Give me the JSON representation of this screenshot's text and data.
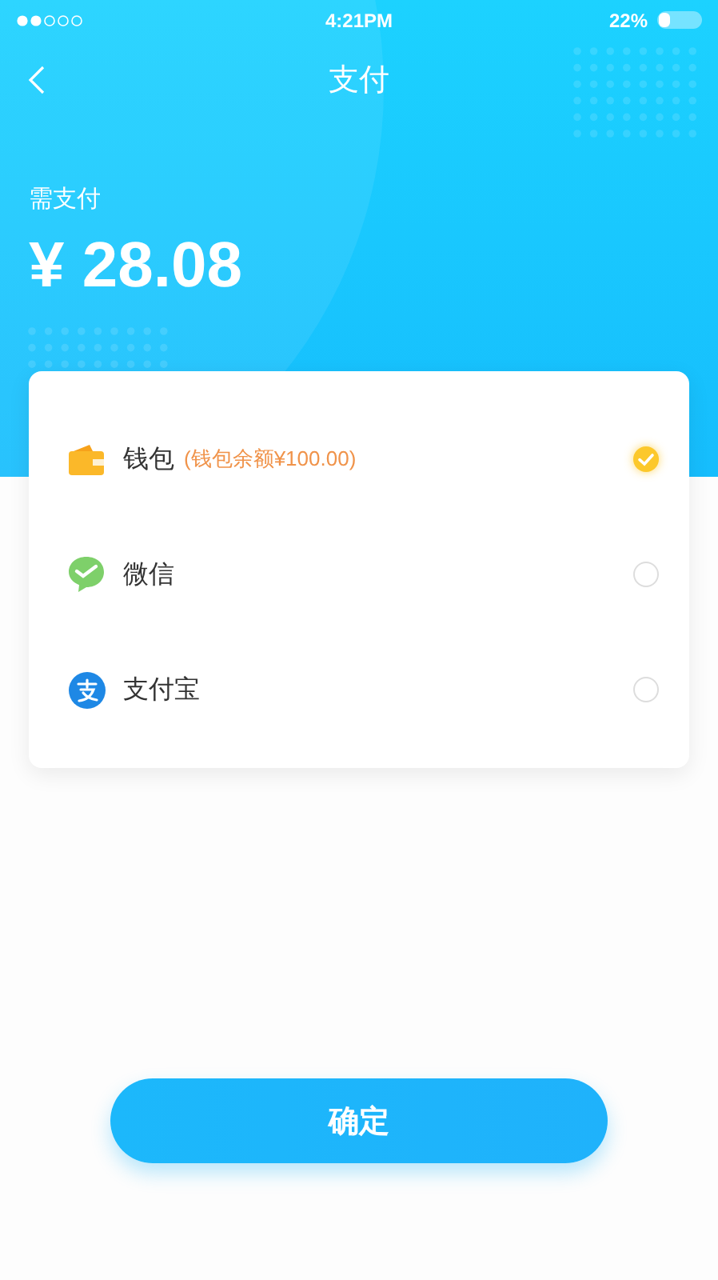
{
  "status_bar": {
    "time": "4:21PM",
    "battery": "22%"
  },
  "nav": {
    "title": "支付"
  },
  "amount": {
    "label": "需支付",
    "value": "¥ 28.08"
  },
  "methods": [
    {
      "kind": "wallet",
      "name": "钱包",
      "note": "(钱包余额¥100.00)",
      "selected": true
    },
    {
      "kind": "wechat",
      "name": "微信",
      "selected": false
    },
    {
      "kind": "alipay",
      "name": "支付宝",
      "selected": false
    }
  ],
  "confirm": "确定"
}
